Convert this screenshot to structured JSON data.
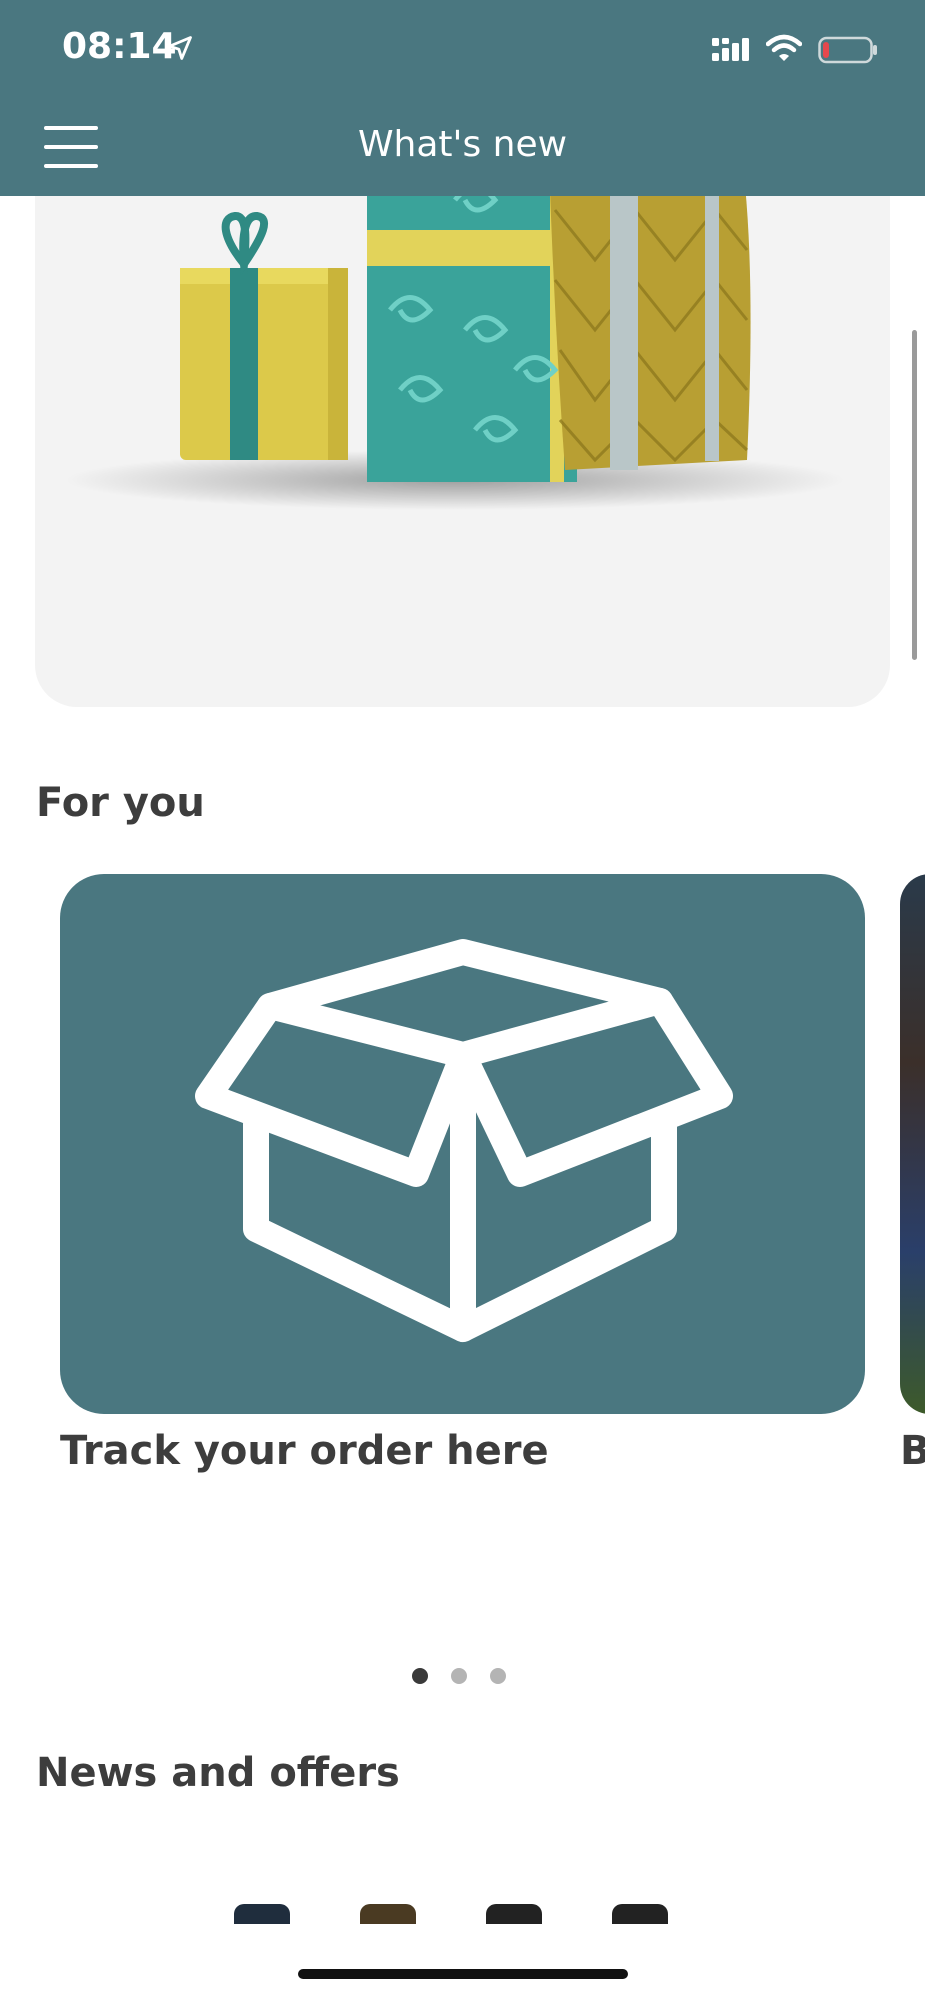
{
  "status_bar": {
    "time": "08:14",
    "icons": [
      "location-arrow-icon",
      "cellular-signal-icon",
      "wifi-icon",
      "battery-low-icon"
    ]
  },
  "header": {
    "title": "What's new",
    "menu_icon": "hamburger-menu-icon"
  },
  "hero": {
    "image": "gift-boxes-illustration"
  },
  "for_you": {
    "title": "For you",
    "cards": [
      {
        "caption": "Track your order here",
        "icon": "open-box-icon",
        "color": "#4a7780"
      },
      {
        "caption": "B",
        "image": "stadium-photo"
      }
    ],
    "pager": {
      "count": 3,
      "active": 0
    }
  },
  "news": {
    "title": "News and offers",
    "thumb_colors": [
      "#1f2d3d",
      "#4a3a22",
      "#222222",
      "#222222"
    ]
  },
  "colors": {
    "brand": "#4a7780",
    "background": "#ffffff",
    "hero_background": "#f3f3f3",
    "text": "#3d3d3d"
  }
}
